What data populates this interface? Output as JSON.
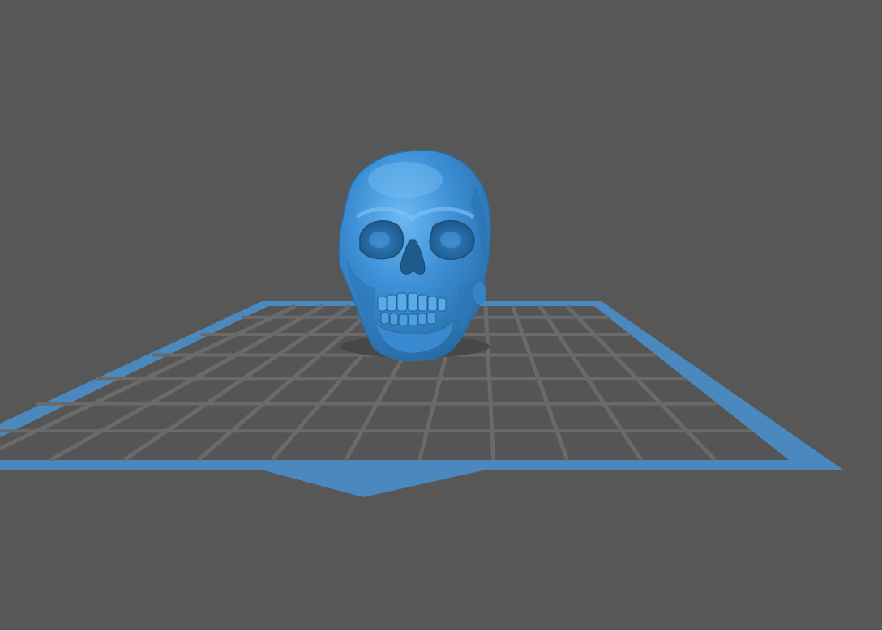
{
  "viewer": {
    "background_color": "#575757",
    "bed": {
      "border_color": "#4a88bd",
      "surface_color": "#555555",
      "grid_color": "#6a6a6a",
      "grid_lines_depth": 7,
      "grid_lines_width": 12
    },
    "model": {
      "icon": "skull-model",
      "color": "#3d8fd6",
      "highlight_color": "#6db7f0",
      "shadow_color": "#1f5c94",
      "selected": false
    }
  }
}
